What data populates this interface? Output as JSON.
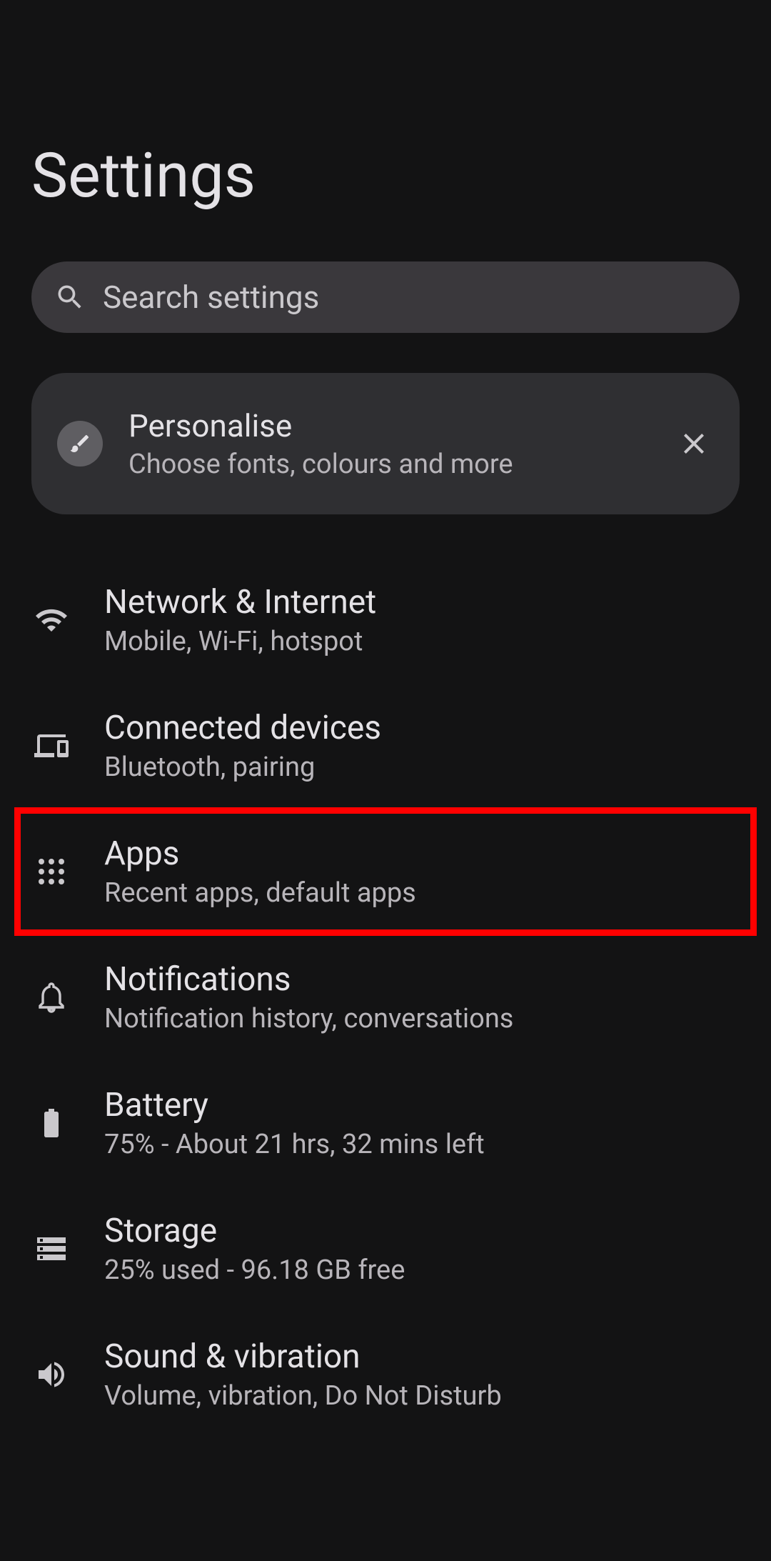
{
  "header": {
    "title": "Settings"
  },
  "search": {
    "placeholder": "Search settings"
  },
  "card": {
    "title": "Personalise",
    "subtitle": "Choose fonts, colours and more"
  },
  "items": [
    {
      "title": "Network & Internet",
      "subtitle": "Mobile, Wi-Fi, hotspot",
      "icon": "wifi"
    },
    {
      "title": "Connected devices",
      "subtitle": "Bluetooth, pairing",
      "icon": "devices"
    },
    {
      "title": "Apps",
      "subtitle": "Recent apps, default apps",
      "icon": "apps",
      "highlighted": true
    },
    {
      "title": "Notifications",
      "subtitle": "Notification history, conversations",
      "icon": "notifications"
    },
    {
      "title": "Battery",
      "subtitle": "75% - About 21 hrs, 32 mins left",
      "icon": "battery"
    },
    {
      "title": "Storage",
      "subtitle": "25% used - 96.18 GB free",
      "icon": "storage"
    },
    {
      "title": "Sound & vibration",
      "subtitle": "Volume, vibration, Do Not Disturb",
      "icon": "sound"
    }
  ]
}
